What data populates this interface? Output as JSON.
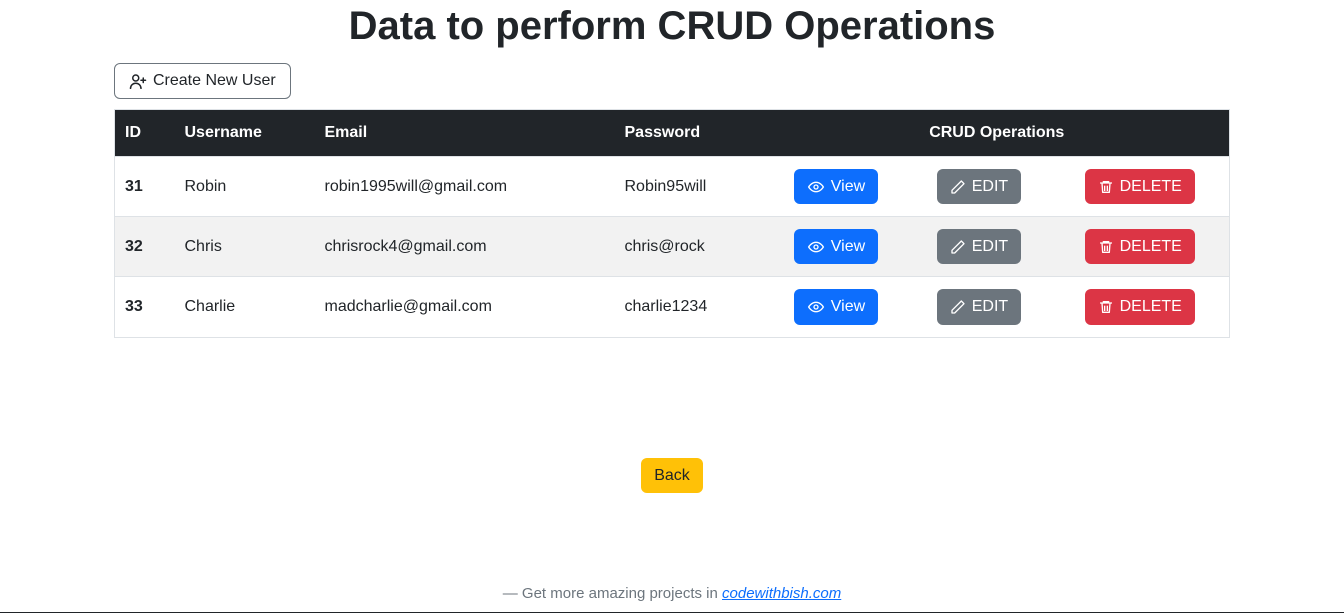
{
  "page": {
    "title": "Data to perform CRUD Operations"
  },
  "buttons": {
    "create_label": "Create New User",
    "view_label": "View",
    "edit_label": "EDIT",
    "delete_label": "DELETE",
    "back_label": "Back"
  },
  "columns": {
    "id": "ID",
    "username": "Username",
    "email": "Email",
    "password": "Password",
    "ops": "CRUD Operations"
  },
  "rows": [
    {
      "id": "31",
      "username": "Robin",
      "email": "robin1995will@gmail.com",
      "password": "Robin95will"
    },
    {
      "id": "32",
      "username": "Chris",
      "email": "chrisrock4@gmail.com",
      "password": "chris@rock"
    },
    {
      "id": "33",
      "username": "Charlie",
      "email": "madcharlie@gmail.com",
      "password": "charlie1234"
    }
  ],
  "footer": {
    "prefix": "— Get more amazing projects in ",
    "link_text": "codewithbish.com"
  }
}
